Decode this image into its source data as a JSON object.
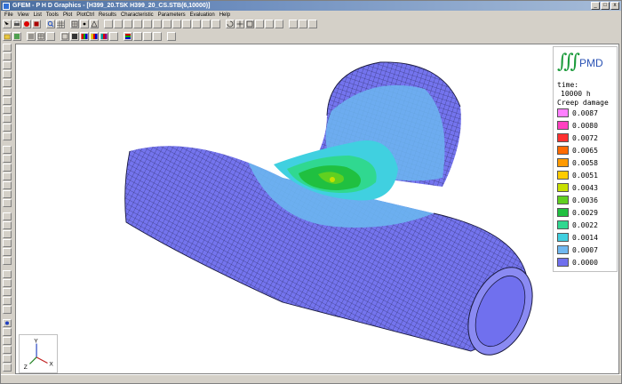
{
  "window": {
    "title": "GFEM - P H D Graphics - [H399_20.TSK  H399_20_CS.STB(6,10000)]"
  },
  "window_buttons": {
    "minimize": "_",
    "maximize": "□",
    "close": "x"
  },
  "menu": [
    "File",
    "View",
    "List",
    "Tools",
    "Plot",
    "PlotCtrl",
    "Results",
    "Characteristic",
    "Parameters",
    "Evaluation",
    "Help"
  ],
  "legend": {
    "logo_text": "PMD",
    "time_label": "time:",
    "time_value": "10000 h",
    "quantity": "Creep damage",
    "scale": [
      {
        "value": "0.0087",
        "color": "#ff80ff"
      },
      {
        "value": "0.0080",
        "color": "#ff40c0"
      },
      {
        "value": "0.0072",
        "color": "#ff3030"
      },
      {
        "value": "0.0065",
        "color": "#ff6a00"
      },
      {
        "value": "0.0058",
        "color": "#ff9a00"
      },
      {
        "value": "0.0051",
        "color": "#ffcc00"
      },
      {
        "value": "0.0043",
        "color": "#c8e000"
      },
      {
        "value": "0.0036",
        "color": "#60d020"
      },
      {
        "value": "0.0029",
        "color": "#20c040"
      },
      {
        "value": "0.0022",
        "color": "#30d890"
      },
      {
        "value": "0.0014",
        "color": "#40d0e0"
      },
      {
        "value": "0.0007",
        "color": "#70b8f0"
      },
      {
        "value": "0.0000",
        "color": "#7070ee"
      }
    ]
  },
  "axes_triad": {
    "y": "Y",
    "z": "Z",
    "x": "X"
  },
  "colors": {
    "mesh_base": "#7474ee",
    "mesh_line": "#1a1a40",
    "titlebar": "#4a6ea0",
    "logo_green": "#1a9a3a",
    "logo_blue": "#2a52b4"
  },
  "toolbar_icons": {
    "row1": [
      "select-icon",
      "print-icon",
      "record-icon",
      "stop-icon",
      "zoom-icon",
      "grid-icon",
      "mesh-icon",
      "node-icon",
      "element-icon",
      "rotate-icon",
      "pan-icon",
      "fit-icon"
    ],
    "row2": [
      "open-icon",
      "save-icon",
      "list-icon",
      "table-icon",
      "layers-icon",
      "results-icon",
      "color-icon",
      "legend-icon",
      "export-icon"
    ]
  }
}
